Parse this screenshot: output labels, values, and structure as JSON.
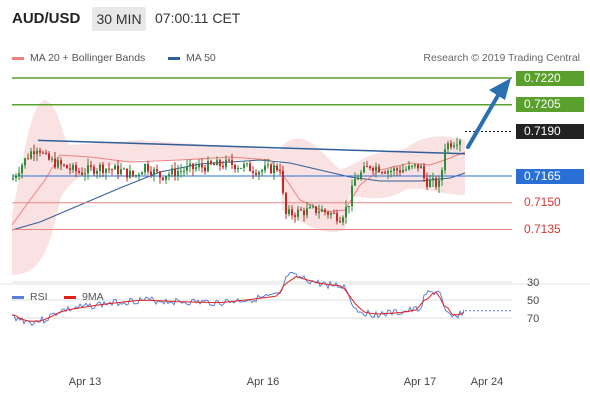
{
  "header": {
    "pair": "AUD/USD",
    "timeframe": "30 MIN",
    "time": "07:00:11 CET"
  },
  "legend": {
    "bollinger": {
      "label": "MA 20 + Bollinger Bands",
      "color": "#f08080"
    },
    "ma50": {
      "label": "MA 50",
      "color": "#2f5f9a"
    },
    "credit": "Research © 2019 Trading Central"
  },
  "rsi_legend": {
    "rsi": {
      "label": "RSI",
      "color": "#5b7fd6"
    },
    "ma9": {
      "label": "9MA",
      "color": "#e0201a"
    }
  },
  "price_levels": [
    {
      "value": "0.7220",
      "style": "green"
    },
    {
      "value": "0.7205",
      "style": "green"
    },
    {
      "value": "0.7190",
      "style": "dark"
    },
    {
      "value": "0.7165",
      "style": "blue"
    },
    {
      "value": "0.7150",
      "style": "red"
    },
    {
      "value": "0.7135",
      "style": "red"
    }
  ],
  "chart_data": {
    "type": "candlestick",
    "y_range": [
      0.7115,
      0.7235
    ],
    "x_labels": [
      "Apr 13",
      "Apr 16",
      "Apr 17",
      "Apr 24"
    ],
    "trendline": {
      "from": 0.7185,
      "to": 0.71775
    },
    "rsi": {
      "y_ticks": [
        70,
        50,
        30
      ],
      "y_range": [
        10,
        90
      ]
    }
  }
}
